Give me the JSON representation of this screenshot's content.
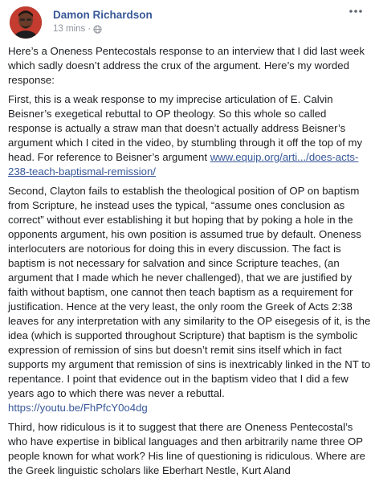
{
  "author": {
    "name": "Damon Richardson",
    "time": "13 mins",
    "separator": "·"
  },
  "icons": {
    "more": "more-options-icon",
    "privacy": "globe-icon"
  },
  "colors": {
    "link": "#385898",
    "text": "#1c1e21",
    "meta": "#90949c"
  },
  "post": {
    "intro": "Here’s a Oneness Pentecostals response to an interview that I did last week which sadly doesn’t address the crux of the argument. Here’s my worded response:",
    "first_text": "First, this is a weak response to my imprecise articulation of E. Calvin Beisner’s exegetical rebuttal to OP theology. So this whole so called response is actually a straw man that doesn’t actually address Beisner’s argument which I cited in the video, by stumbling through it off the top of my head. For reference to Beisner’s argument ",
    "first_link": "www.equip.org/arti.../does-acts-238-teach-baptismal-remission/",
    "second_text": "Second, Clayton fails to establish the theological position of OP on baptism from Scripture, he instead uses the typical, “assume ones conclusion as correct” without ever establishing it but hoping that by poking a hole in the opponents argument, his own position is assumed true by default. Oneness interlocuters are notorious for doing this in every discussion. The fact is baptism is not necessary for salvation and since Scripture teaches, (an argument that I made which he never challenged), that we are justified by faith without baptism, one cannot then teach baptism as a requirement for justification. Hence at the very least, the only room the Greek of Acts 2:38 leaves for any interpretation with any similarity to the OP eisegesis of it, is the idea (which is supported throughout Scripture) that baptism is the symbolic expression of remission of sins but doesn’t remit sins itself which in fact supports my argument that remission of sins is inextricably linked in the NT to repentance. I point that evidence out in the baptism video that I did a few years ago to which there was never a rebuttal.",
    "second_link": "https://youtu.be/FhPfcY0o4dg",
    "third_text": "Third, how ridiculous is it to suggest that there are Oneness Pentecostal’s who have expertise in biblical languages and then arbitrarily name three OP people known for what work? His line of questioning is ridiculous. Where are the Greek linguistic scholars like Eberhart Nestle, Kurt Aland"
  }
}
